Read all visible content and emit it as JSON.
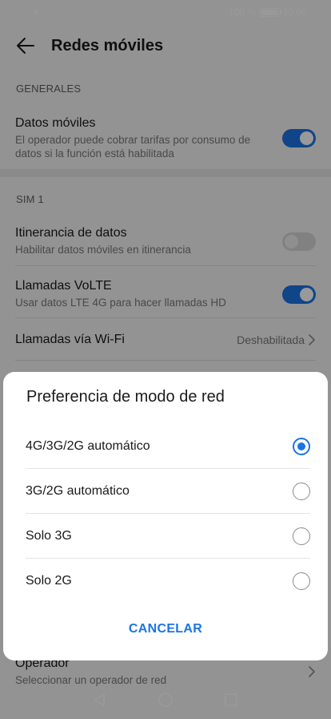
{
  "status_bar": {
    "signal": "..ıl",
    "battery_text": "100 %",
    "time": "10:00",
    "battery_level": 1.0
  },
  "header": {
    "title": "Redes móviles",
    "back_icon": "arrow-left-icon"
  },
  "sections": {
    "general": {
      "label": "GENERALES",
      "mobile_data": {
        "title": "Datos móviles",
        "subtitle": "El operador puede cobrar tarifas por consumo de datos si la función está habilitada",
        "enabled": true
      }
    },
    "sim1": {
      "label": "SIM 1",
      "roaming": {
        "title": "Itinerancia de datos",
        "subtitle": "Habilitar datos móviles en itinerancia",
        "enabled": false
      },
      "volte": {
        "title": "Llamadas VoLTE",
        "subtitle": "Usar datos LTE 4G para hacer llamadas HD",
        "enabled": true
      },
      "wifi_calling": {
        "title": "Llamadas vía Wi-Fi",
        "value": "Deshabilitada"
      },
      "operator": {
        "title": "Operador",
        "subtitle": "Seleccionar un operador de red"
      }
    }
  },
  "dialog": {
    "title": "Preferencia de modo de red",
    "options": [
      {
        "label": "4G/3G/2G automático",
        "selected": true
      },
      {
        "label": "3G/2G automático",
        "selected": false
      },
      {
        "label": "Solo 3G",
        "selected": false
      },
      {
        "label": "Solo 2G",
        "selected": false
      }
    ],
    "cancel_label": "CANCELAR"
  },
  "colors": {
    "accent": "#1b74e4",
    "background": "#f5f5f5",
    "overlay": "rgba(0,0,0,0.40)"
  }
}
